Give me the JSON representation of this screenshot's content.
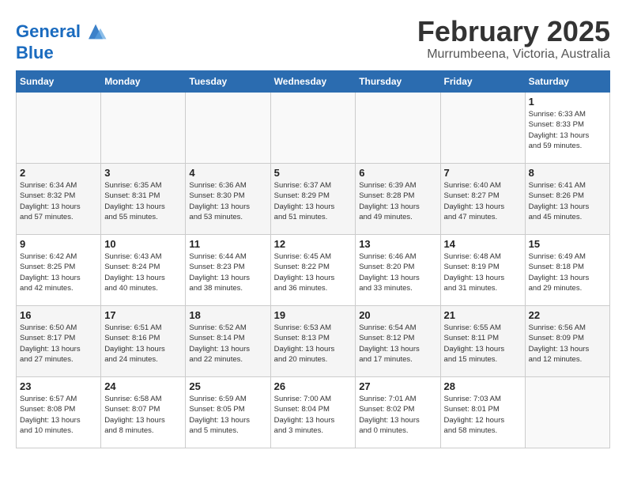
{
  "header": {
    "logo_line1": "General",
    "logo_line2": "Blue",
    "month_year": "February 2025",
    "location": "Murrumbeena, Victoria, Australia"
  },
  "days_of_week": [
    "Sunday",
    "Monday",
    "Tuesday",
    "Wednesday",
    "Thursday",
    "Friday",
    "Saturday"
  ],
  "weeks": [
    [
      {
        "day": "",
        "info": ""
      },
      {
        "day": "",
        "info": ""
      },
      {
        "day": "",
        "info": ""
      },
      {
        "day": "",
        "info": ""
      },
      {
        "day": "",
        "info": ""
      },
      {
        "day": "",
        "info": ""
      },
      {
        "day": "1",
        "info": "Sunrise: 6:33 AM\nSunset: 8:33 PM\nDaylight: 13 hours\nand 59 minutes."
      }
    ],
    [
      {
        "day": "2",
        "info": "Sunrise: 6:34 AM\nSunset: 8:32 PM\nDaylight: 13 hours\nand 57 minutes."
      },
      {
        "day": "3",
        "info": "Sunrise: 6:35 AM\nSunset: 8:31 PM\nDaylight: 13 hours\nand 55 minutes."
      },
      {
        "day": "4",
        "info": "Sunrise: 6:36 AM\nSunset: 8:30 PM\nDaylight: 13 hours\nand 53 minutes."
      },
      {
        "day": "5",
        "info": "Sunrise: 6:37 AM\nSunset: 8:29 PM\nDaylight: 13 hours\nand 51 minutes."
      },
      {
        "day": "6",
        "info": "Sunrise: 6:39 AM\nSunset: 8:28 PM\nDaylight: 13 hours\nand 49 minutes."
      },
      {
        "day": "7",
        "info": "Sunrise: 6:40 AM\nSunset: 8:27 PM\nDaylight: 13 hours\nand 47 minutes."
      },
      {
        "day": "8",
        "info": "Sunrise: 6:41 AM\nSunset: 8:26 PM\nDaylight: 13 hours\nand 45 minutes."
      }
    ],
    [
      {
        "day": "9",
        "info": "Sunrise: 6:42 AM\nSunset: 8:25 PM\nDaylight: 13 hours\nand 42 minutes."
      },
      {
        "day": "10",
        "info": "Sunrise: 6:43 AM\nSunset: 8:24 PM\nDaylight: 13 hours\nand 40 minutes."
      },
      {
        "day": "11",
        "info": "Sunrise: 6:44 AM\nSunset: 8:23 PM\nDaylight: 13 hours\nand 38 minutes."
      },
      {
        "day": "12",
        "info": "Sunrise: 6:45 AM\nSunset: 8:22 PM\nDaylight: 13 hours\nand 36 minutes."
      },
      {
        "day": "13",
        "info": "Sunrise: 6:46 AM\nSunset: 8:20 PM\nDaylight: 13 hours\nand 33 minutes."
      },
      {
        "day": "14",
        "info": "Sunrise: 6:48 AM\nSunset: 8:19 PM\nDaylight: 13 hours\nand 31 minutes."
      },
      {
        "day": "15",
        "info": "Sunrise: 6:49 AM\nSunset: 8:18 PM\nDaylight: 13 hours\nand 29 minutes."
      }
    ],
    [
      {
        "day": "16",
        "info": "Sunrise: 6:50 AM\nSunset: 8:17 PM\nDaylight: 13 hours\nand 27 minutes."
      },
      {
        "day": "17",
        "info": "Sunrise: 6:51 AM\nSunset: 8:16 PM\nDaylight: 13 hours\nand 24 minutes."
      },
      {
        "day": "18",
        "info": "Sunrise: 6:52 AM\nSunset: 8:14 PM\nDaylight: 13 hours\nand 22 minutes."
      },
      {
        "day": "19",
        "info": "Sunrise: 6:53 AM\nSunset: 8:13 PM\nDaylight: 13 hours\nand 20 minutes."
      },
      {
        "day": "20",
        "info": "Sunrise: 6:54 AM\nSunset: 8:12 PM\nDaylight: 13 hours\nand 17 minutes."
      },
      {
        "day": "21",
        "info": "Sunrise: 6:55 AM\nSunset: 8:11 PM\nDaylight: 13 hours\nand 15 minutes."
      },
      {
        "day": "22",
        "info": "Sunrise: 6:56 AM\nSunset: 8:09 PM\nDaylight: 13 hours\nand 12 minutes."
      }
    ],
    [
      {
        "day": "23",
        "info": "Sunrise: 6:57 AM\nSunset: 8:08 PM\nDaylight: 13 hours\nand 10 minutes."
      },
      {
        "day": "24",
        "info": "Sunrise: 6:58 AM\nSunset: 8:07 PM\nDaylight: 13 hours\nand 8 minutes."
      },
      {
        "day": "25",
        "info": "Sunrise: 6:59 AM\nSunset: 8:05 PM\nDaylight: 13 hours\nand 5 minutes."
      },
      {
        "day": "26",
        "info": "Sunrise: 7:00 AM\nSunset: 8:04 PM\nDaylight: 13 hours\nand 3 minutes."
      },
      {
        "day": "27",
        "info": "Sunrise: 7:01 AM\nSunset: 8:02 PM\nDaylight: 13 hours\nand 0 minutes."
      },
      {
        "day": "28",
        "info": "Sunrise: 7:03 AM\nSunset: 8:01 PM\nDaylight: 12 hours\nand 58 minutes."
      },
      {
        "day": "",
        "info": ""
      }
    ]
  ]
}
